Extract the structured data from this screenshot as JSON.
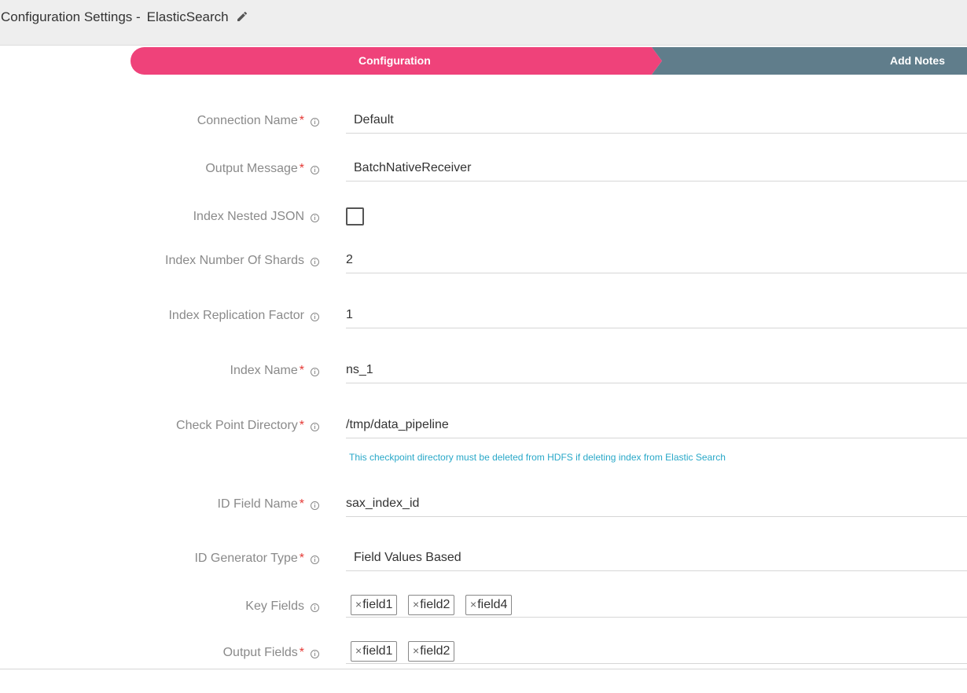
{
  "header": {
    "title_prefix": "Configuration Settings -",
    "component": "ElasticSearch",
    "edit_icon": "pencil-icon"
  },
  "steps": {
    "configuration": "Configuration",
    "add_notes": "Add Notes",
    "active_color": "#ef427a",
    "inactive_color": "#607d8b"
  },
  "form": {
    "connection_name": {
      "label": "Connection Name",
      "value": "Default"
    },
    "output_message": {
      "label": "Output Message",
      "value": "BatchNativeReceiver"
    },
    "index_nested_json": {
      "label": "Index Nested JSON",
      "checked": false
    },
    "index_number_of_shards": {
      "label": "Index Number Of Shards",
      "value": "2"
    },
    "index_replication_factor": {
      "label": "Index Replication Factor",
      "value": "1"
    },
    "index_name": {
      "label": "Index Name",
      "value": "ns_1"
    },
    "check_point_directory": {
      "label": "Check Point Directory",
      "value": "/tmp/data_pipeline",
      "hint": "This checkpoint directory must be deleted from HDFS if deleting index from Elastic Search"
    },
    "id_field_name": {
      "label": "ID Field Name",
      "value": "sax_index_id"
    },
    "id_generator_type": {
      "label": "ID Generator Type",
      "value": "Field Values Based"
    },
    "key_fields": {
      "label": "Key Fields",
      "tags": [
        "field1",
        "field2",
        "field4"
      ]
    },
    "output_fields": {
      "label": "Output Fields",
      "tags": [
        "field1",
        "field2"
      ]
    },
    "required_mark": "*",
    "tag_remove": "×"
  }
}
